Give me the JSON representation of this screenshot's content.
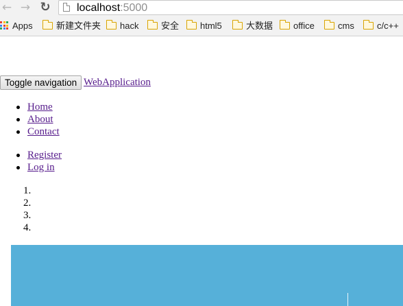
{
  "browser": {
    "url_host": "localhost",
    "url_port": ":5000",
    "bookmarks": [
      {
        "label": "Apps",
        "icon": "apps-grid-icon"
      },
      {
        "label": "新建文件夹",
        "icon": "folder-icon"
      },
      {
        "label": "hack",
        "icon": "folder-icon"
      },
      {
        "label": "安全",
        "icon": "folder-icon"
      },
      {
        "label": "html5",
        "icon": "folder-icon"
      },
      {
        "label": "大数据",
        "icon": "folder-icon"
      },
      {
        "label": "office",
        "icon": "folder-icon"
      },
      {
        "label": "cms",
        "icon": "folder-icon"
      },
      {
        "label": "c/c++",
        "icon": "folder-icon"
      }
    ]
  },
  "navbar": {
    "toggle_label": "Toggle navigation",
    "brand": "WebApplication",
    "main_links": [
      "Home",
      "About",
      "Contact"
    ],
    "account_links": [
      "Register",
      "Log in"
    ]
  },
  "carousel": {
    "indicators": [
      "1.",
      "2.",
      "3.",
      "4."
    ],
    "colors": {
      "slide_background": "#56b0d9"
    }
  },
  "colors": {
    "link": "#551a8b"
  }
}
